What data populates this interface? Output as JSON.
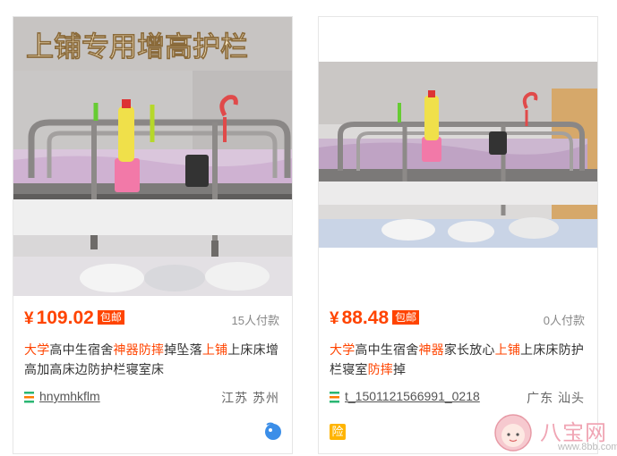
{
  "cards": [
    {
      "overlay_text": "上铺专用增高护栏",
      "price": "109.02",
      "currency": "¥",
      "badge": "包邮",
      "paid_count": "15人付款",
      "title_segments": [
        {
          "text": "大学",
          "hl": true
        },
        {
          "text": "高中生宿舍",
          "hl": false
        },
        {
          "text": "神器",
          "hl": true
        },
        {
          "text": "防摔",
          "hl": true
        },
        {
          "text": "掉坠落",
          "hl": false
        },
        {
          "text": "上铺",
          "hl": true
        },
        {
          "text": "上床床增高加高床边防护栏寝室床",
          "hl": false
        }
      ],
      "shop_name": "hnymhkflm",
      "location": "江苏 苏州",
      "bottom_icon": "wangwang-chat-icon"
    },
    {
      "price": "88.48",
      "currency": "¥",
      "badge": "包邮",
      "paid_count": "0人付款",
      "title_segments": [
        {
          "text": "大学",
          "hl": true
        },
        {
          "text": "高中生宿舍",
          "hl": false
        },
        {
          "text": "神器",
          "hl": true
        },
        {
          "text": "家长放心",
          "hl": false
        },
        {
          "text": "上铺",
          "hl": true
        },
        {
          "text": "上床床防护栏寝室",
          "hl": false
        },
        {
          "text": "防摔",
          "hl": true
        },
        {
          "text": "掉",
          "hl": false
        }
      ],
      "shop_name": "t_1501121566991_0218",
      "location": "广东 汕头",
      "bottom_icon": "insurance-badge-icon",
      "bottom_icon_text": "险"
    }
  ],
  "watermark": {
    "site": "八宝网",
    "url": "www.8bb.com"
  },
  "colors": {
    "accent": "#ff4400",
    "shop_icon_green": "#2bb673",
    "shop_icon_orange": "#ff7a00"
  }
}
